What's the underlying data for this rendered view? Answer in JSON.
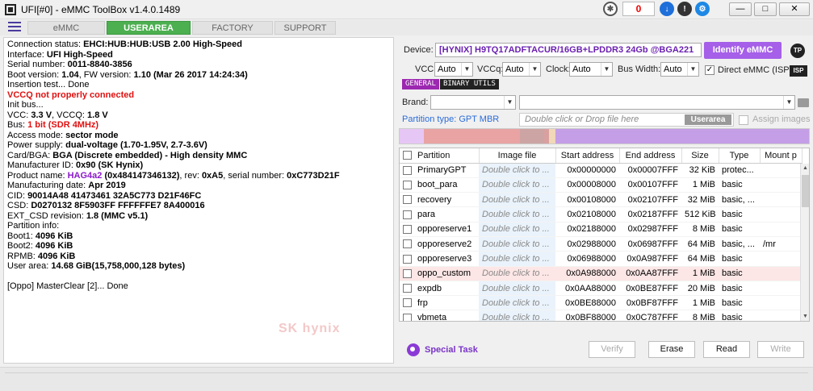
{
  "window": {
    "title": "UFI[#0] - eMMC ToolBox v1.4.0.1489",
    "counter": "0",
    "controls": [
      "—",
      "□",
      "✕"
    ]
  },
  "tabs": [
    {
      "label": "eMMC GENERAL",
      "active": false
    },
    {
      "label": "USERAREA PART",
      "active": true
    },
    {
      "label": "FACTORY IMAGE",
      "active": false
    },
    {
      "label": "SUPPORT",
      "active": false
    }
  ],
  "log": {
    "connection_label": "Connection status: ",
    "connection_value": "EHCI:HUB:HUB:USB 2.00 High-Speed",
    "interface_label": "Interface: ",
    "interface_value": "UFI High-Speed",
    "serial_label": "Serial number: ",
    "serial_value": "0011-8840-3856",
    "boot_label": " Boot version: ",
    "boot_value": "1.04",
    "fw_label": ", FW version: ",
    "fw_value": "1.10 (Mar 26 2017 14:24:34)",
    "insertion": "Insertion test... Done",
    "vccq_warning": "VCCQ not properly connected",
    "init": "Init bus...",
    "vcc_label": "VCC: ",
    "vcc_value": "3.3 V",
    "vccq_label": ", VCCQ: ",
    "vccq_value": "1.8 V",
    "bus_label": "Bus: ",
    "bus_value": "1 bit (SDR 4MHz)",
    "access_label": "Access mode: ",
    "access_value": "sector mode",
    "power_label": "Power supply: ",
    "power_value": "dual-voltage (1.70-1.95V, 2.7-3.6V)",
    "card_label": " Card/BGA: ",
    "card_value": "BGA (Discrete embedded) - High density MMC",
    "manuf_label": " Manufacturer ID: ",
    "manuf_value": "0x90 (SK Hynix)",
    "product_label": " Product name: ",
    "product_value": "HAG4a2",
    "product_hex": " (0x484147346132)",
    "rev_label": ", rev: ",
    "rev_value": "0xA5",
    "sn_label": ", serial number: ",
    "sn_value": "0xC773D21F",
    "mdate_label": " Manufacturing date: ",
    "mdate_value": "Apr 2019",
    "cid_label": "CID: ",
    "cid_value": "90014A48 41473461 32A5C773 D21F46FC",
    "csd_label": "CSD: ",
    "csd_value": "D0270132 8F5903FF FFFFFFE7 8A400016",
    "extcsd_label": "EXT_CSD revision: ",
    "extcsd_value": "1.8 (MMC v5.1)",
    "partition_info": "Partition info:",
    "boot1_label": " Boot1: ",
    "boot1_value": "4096 KiB",
    "boot2_label": " Boot2: ",
    "boot2_value": "4096 KiB",
    "rpmb_label": " RPMB: ",
    "rpmb_value": "4096 KiB",
    "user_label": " User area: ",
    "user_value": "14.68 GiB(15,758,000,128 bytes)",
    "master_clear": "[Oppo] MasterClear [2]... Done",
    "watermark": "SK hynix"
  },
  "device": {
    "label": "Device:",
    "value": "[HYNIX] H9TQ17ADFTACUR/16GB+LPDDR3 24Gb  @BGA221",
    "identify_label": "Identify eMMC",
    "tp_label": "TP"
  },
  "settings": {
    "vcc_label": "VCC:",
    "vcc_value": "Auto",
    "vccq_label": "VCCq:",
    "vccq_value": "Auto",
    "clock_label": "Clock:",
    "clock_value": "Auto",
    "bus_label": "Bus Width:",
    "bus_value": "Auto",
    "direct_label": "Direct eMMC (ISP)",
    "isp_label": "ISP"
  },
  "subtabs": [
    {
      "label": "GENERAL",
      "active": true
    },
    {
      "label": "BINARY UTILS",
      "active": false
    }
  ],
  "brand": {
    "label": "Brand:"
  },
  "partition_type": "Partition type: GPT MBR",
  "drop_placeholder": "Double click or Drop file here",
  "userarea_tag": "Userarea",
  "assign_label": "Assign images",
  "partition_bar_colors": [
    "#e6c6f5",
    "#e9a3a3",
    "#cda4a4",
    "#d9a0a0",
    "#f0d8b8",
    "#c49ee6"
  ],
  "table": {
    "headers": [
      "Partition",
      "Image file",
      "Start address",
      "End address",
      "Size",
      "Type",
      "Mount p"
    ],
    "image_placeholder": "Double click to ...",
    "rows": [
      {
        "name": "PrimaryGPT",
        "start": "0x00000000",
        "end": "0x00007FFF",
        "size": "32 KiB",
        "type": "protec...",
        "mount": ""
      },
      {
        "name": "boot_para",
        "start": "0x00008000",
        "end": "0x00107FFF",
        "size": "1 MiB",
        "type": "basic",
        "mount": ""
      },
      {
        "name": "recovery",
        "start": "0x00108000",
        "end": "0x02107FFF",
        "size": "32 MiB",
        "type": "basic, ...",
        "mount": ""
      },
      {
        "name": "para",
        "start": "0x02108000",
        "end": "0x02187FFF",
        "size": "512 KiB",
        "type": "basic",
        "mount": ""
      },
      {
        "name": "opporeserve1",
        "start": "0x02188000",
        "end": "0x02987FFF",
        "size": "8 MiB",
        "type": "basic",
        "mount": ""
      },
      {
        "name": "opporeserve2",
        "start": "0x02988000",
        "end": "0x06987FFF",
        "size": "64 MiB",
        "type": "basic, ...",
        "mount": "/mr"
      },
      {
        "name": "opporeserve3",
        "start": "0x06988000",
        "end": "0x0A987FFF",
        "size": "64 MiB",
        "type": "basic",
        "mount": ""
      },
      {
        "name": "oppo_custom",
        "start": "0x0A988000",
        "end": "0x0AA87FFF",
        "size": "1 MiB",
        "type": "basic",
        "mount": ""
      },
      {
        "name": "expdb",
        "start": "0x0AA88000",
        "end": "0x0BE87FFF",
        "size": "20 MiB",
        "type": "basic",
        "mount": ""
      },
      {
        "name": "frp",
        "start": "0x0BE88000",
        "end": "0x0BF87FFF",
        "size": "1 MiB",
        "type": "basic",
        "mount": ""
      },
      {
        "name": "vbmeta",
        "start": "0x0BF88000",
        "end": "0x0C787FFF",
        "size": "8 MiB",
        "type": "basic",
        "mount": ""
      }
    ]
  },
  "actions": {
    "special_task": "Special Task",
    "verify": "Verify",
    "erase": "Erase",
    "read": "Read",
    "write": "Write"
  }
}
